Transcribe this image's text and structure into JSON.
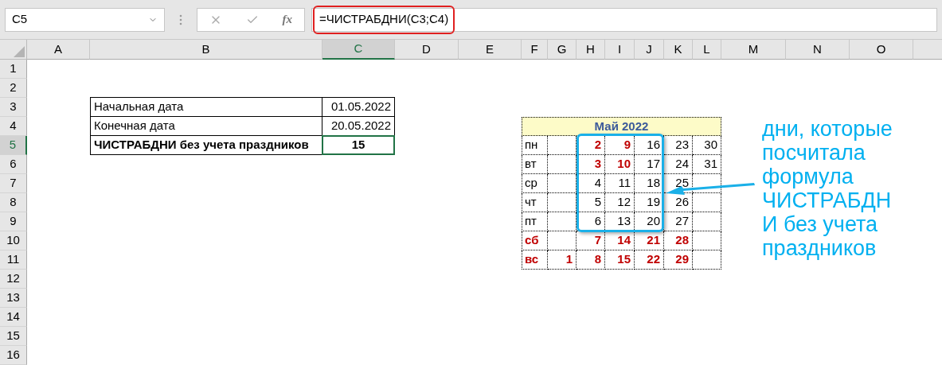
{
  "name_box": {
    "value": "C5"
  },
  "formula_bar": {
    "function_label": "fx",
    "formula": "=ЧИСТРАБДНИ(C3;C4)"
  },
  "columns": [
    {
      "label": "A",
      "selected": false
    },
    {
      "label": "B",
      "selected": false
    },
    {
      "label": "C",
      "selected": true
    },
    {
      "label": "D",
      "selected": false
    },
    {
      "label": "E",
      "selected": false
    },
    {
      "label": "F",
      "selected": false
    },
    {
      "label": "G",
      "selected": false
    },
    {
      "label": "H",
      "selected": false
    },
    {
      "label": "I",
      "selected": false
    },
    {
      "label": "J",
      "selected": false
    },
    {
      "label": "K",
      "selected": false
    },
    {
      "label": "L",
      "selected": false
    },
    {
      "label": "M",
      "selected": false
    },
    {
      "label": "N",
      "selected": false
    },
    {
      "label": "O",
      "selected": false
    }
  ],
  "rows": [
    {
      "label": "1",
      "selected": false
    },
    {
      "label": "2",
      "selected": false
    },
    {
      "label": "3",
      "selected": false
    },
    {
      "label": "4",
      "selected": false
    },
    {
      "label": "5",
      "selected": true
    },
    {
      "label": "6",
      "selected": false
    },
    {
      "label": "7",
      "selected": false
    },
    {
      "label": "8",
      "selected": false
    },
    {
      "label": "9",
      "selected": false
    },
    {
      "label": "10",
      "selected": false
    },
    {
      "label": "11",
      "selected": false
    },
    {
      "label": "12",
      "selected": false
    },
    {
      "label": "13",
      "selected": false
    },
    {
      "label": "14",
      "selected": false
    },
    {
      "label": "15",
      "selected": false
    },
    {
      "label": "16",
      "selected": false
    }
  ],
  "table": [
    {
      "label": "Начальная дата",
      "value": "01.05.2022",
      "bold": false,
      "selected": false
    },
    {
      "label": "Конечная дата",
      "value": "20.05.2022",
      "bold": false,
      "selected": false
    },
    {
      "label": "ЧИСТРАБДНИ без учета праздников",
      "value": "15",
      "bold": true,
      "selected": true
    }
  ],
  "calendar": {
    "title": "Май 2022",
    "days": [
      {
        "label": "пн",
        "holiday": false,
        "cells": [
          {
            "kind": "blank"
          },
          {
            "kind": "date",
            "text": "2",
            "holiday": true
          },
          {
            "kind": "date",
            "text": "9",
            "holiday": true
          },
          {
            "kind": "date",
            "text": "16",
            "holiday": false
          },
          {
            "kind": "date",
            "text": "23",
            "holiday": false
          },
          {
            "kind": "date",
            "text": "30",
            "holiday": false
          }
        ]
      },
      {
        "label": "вт",
        "holiday": false,
        "cells": [
          {
            "kind": "blank"
          },
          {
            "kind": "date",
            "text": "3",
            "holiday": true
          },
          {
            "kind": "date",
            "text": "10",
            "holiday": true
          },
          {
            "kind": "date",
            "text": "17",
            "holiday": false
          },
          {
            "kind": "date",
            "text": "24",
            "holiday": false
          },
          {
            "kind": "date",
            "text": "31",
            "holiday": false
          }
        ]
      },
      {
        "label": "ср",
        "holiday": false,
        "cells": [
          {
            "kind": "blank"
          },
          {
            "kind": "date",
            "text": "4",
            "holiday": false
          },
          {
            "kind": "date",
            "text": "11",
            "holiday": false
          },
          {
            "kind": "date",
            "text": "18",
            "holiday": false
          },
          {
            "kind": "date",
            "text": "25",
            "holiday": false
          },
          {
            "kind": "blank"
          }
        ]
      },
      {
        "label": "чт",
        "holiday": false,
        "cells": [
          {
            "kind": "blank"
          },
          {
            "kind": "date",
            "text": "5",
            "holiday": false
          },
          {
            "kind": "date",
            "text": "12",
            "holiday": false
          },
          {
            "kind": "date",
            "text": "19",
            "holiday": false
          },
          {
            "kind": "date",
            "text": "26",
            "holiday": false
          },
          {
            "kind": "blank"
          }
        ]
      },
      {
        "label": "пт",
        "holiday": false,
        "cells": [
          {
            "kind": "blank"
          },
          {
            "kind": "date",
            "text": "6",
            "holiday": false
          },
          {
            "kind": "date",
            "text": "13",
            "holiday": false
          },
          {
            "kind": "date",
            "text": "20",
            "holiday": false
          },
          {
            "kind": "date",
            "text": "27",
            "holiday": false
          },
          {
            "kind": "blank"
          }
        ]
      },
      {
        "label": "сб",
        "holiday": true,
        "cells": [
          {
            "kind": "blank"
          },
          {
            "kind": "date",
            "text": "7",
            "holiday": true
          },
          {
            "kind": "date",
            "text": "14",
            "holiday": true
          },
          {
            "kind": "date",
            "text": "21",
            "holiday": true
          },
          {
            "kind": "date",
            "text": "28",
            "holiday": true
          },
          {
            "kind": "blank"
          }
        ]
      },
      {
        "label": "вс",
        "holiday": true,
        "cells": [
          {
            "kind": "date",
            "text": "1",
            "holiday": true
          },
          {
            "kind": "date",
            "text": "8",
            "holiday": true
          },
          {
            "kind": "date",
            "text": "15",
            "holiday": true
          },
          {
            "kind": "date",
            "text": "22",
            "holiday": true
          },
          {
            "kind": "date",
            "text": "29",
            "holiday": true
          },
          {
            "kind": "blank"
          }
        ]
      }
    ]
  },
  "annotation": {
    "text": "дни, которые\nпосчитала\nформула\nЧИСТРАБДН\nИ без учета\nпраздников"
  }
}
